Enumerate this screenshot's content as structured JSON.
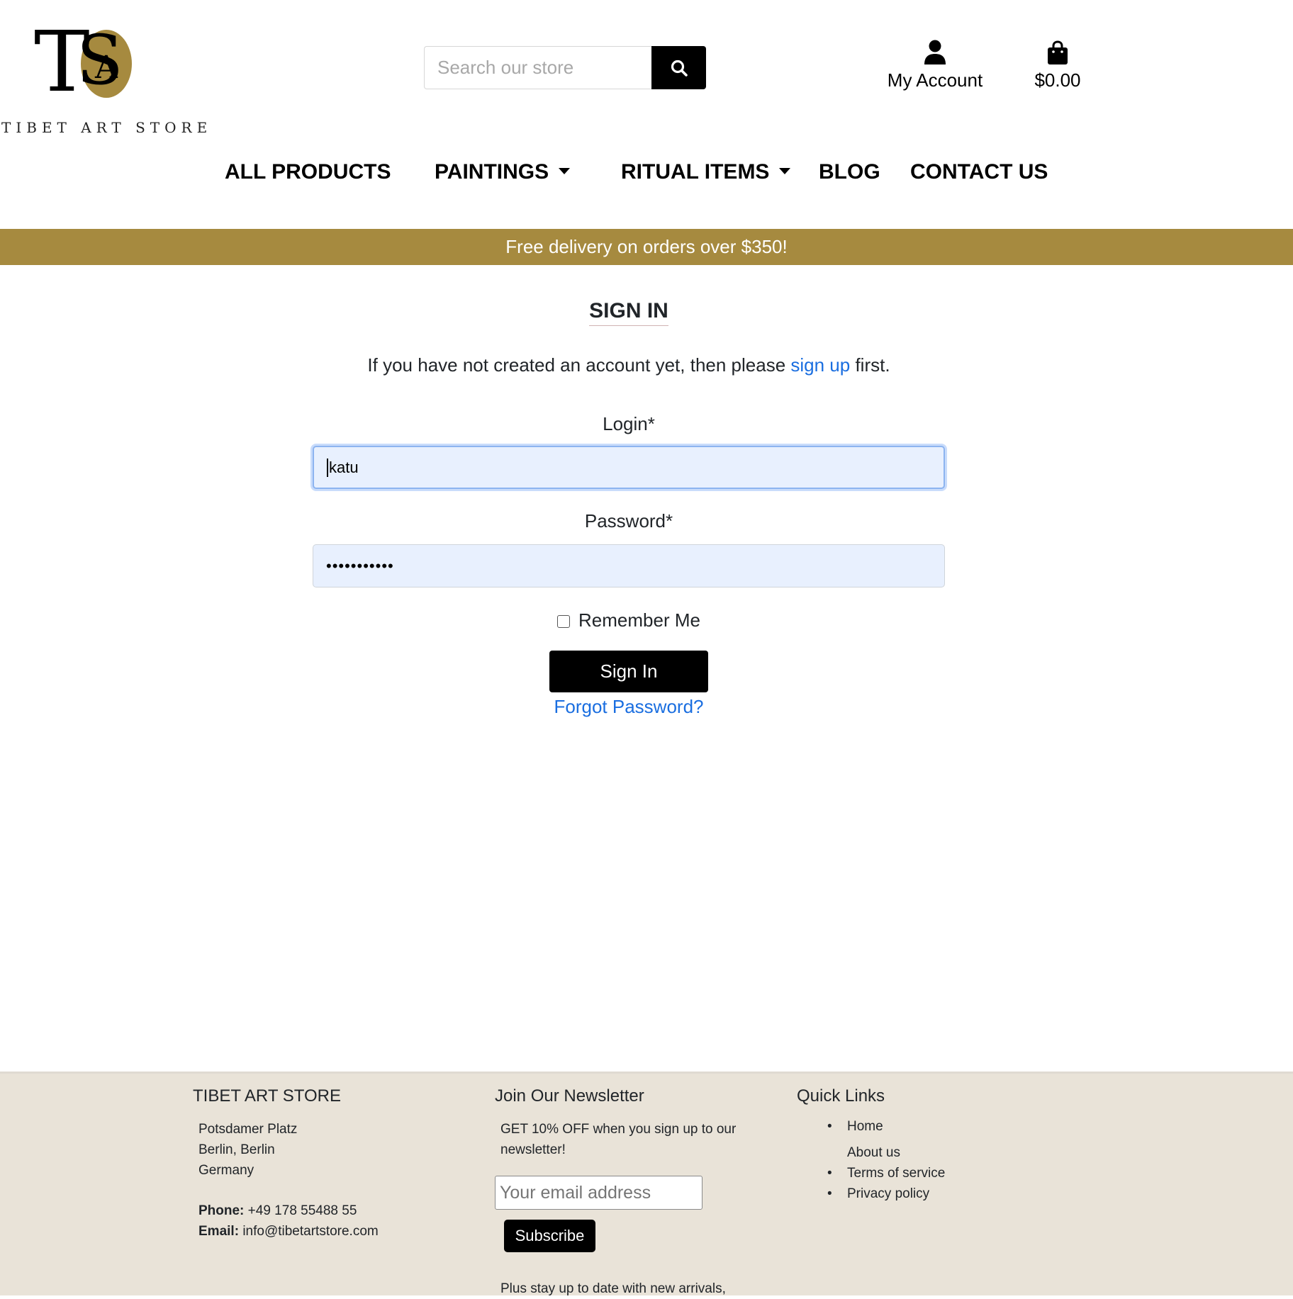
{
  "header": {
    "logo_text": "TIBET ART STORE",
    "logo_monogram": "TAS",
    "search_placeholder": "Search our store",
    "account_label": "My Account",
    "cart_total": "$0.00"
  },
  "nav": {
    "items": [
      {
        "label": "ALL PRODUCTS"
      },
      {
        "label": "PAINTINGS"
      },
      {
        "label": "RITUAL ITEMS"
      },
      {
        "label": "BLOG"
      },
      {
        "label": "CONTACT US"
      }
    ]
  },
  "banner": "Free delivery on orders over $350!",
  "signin": {
    "title": "SIGN IN",
    "intro_before": "If you have not created an account yet, then please ",
    "intro_link": "sign up",
    "intro_after": " first.",
    "login_label": "Login*",
    "login_value": "katu",
    "password_label": "Password*",
    "password_value": "•••••••••••",
    "remember_label": "Remember Me",
    "remember_checked": false,
    "button": "Sign In",
    "forgot": "Forgot Password?"
  },
  "footer": {
    "store": {
      "title": "TIBET ART STORE",
      "address": [
        "Potsdamer Platz",
        "Berlin, Berlin",
        "Germany"
      ],
      "phone_label": "Phone:",
      "phone": "+49 178 55488 55",
      "email_label": "Email:",
      "email": "info@tibetartstore.com"
    },
    "newsletter": {
      "title": "Join Our Newsletter",
      "text": "GET 10% OFF when you sign up to our newsletter!",
      "placeholder": "Your email address",
      "button": "Subscribe",
      "more": "Plus stay up to date with new arrivals,"
    },
    "quick_links": {
      "title": "Quick Links",
      "items": [
        "Home",
        "About us",
        "Terms of service",
        "Privacy policy"
      ]
    }
  },
  "colors": {
    "accent_gold": "#a68a3f",
    "link_blue": "#1a6ee0",
    "footer_bg": "#e9e3d8",
    "input_fill": "#e8f0fe"
  },
  "icons": [
    "search-icon",
    "user-icon",
    "shopping-bag-icon",
    "caret-down-icon"
  ]
}
